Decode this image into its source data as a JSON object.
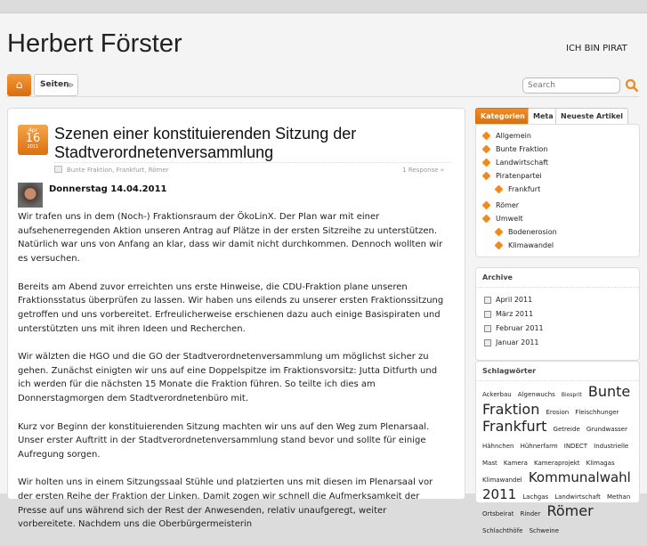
{
  "site": {
    "title": "Herbert Förster",
    "tagline": "ICH BIN PIRAT"
  },
  "nav": {
    "home_icon": "home-icon",
    "seiten_label": "Seiten",
    "search_placeholder": "Search"
  },
  "post": {
    "date": {
      "month": "Apr",
      "day": "16",
      "year": "2011"
    },
    "title": "Szenen einer konstituierenden Sitzung der Stadtverordnetenversammlung",
    "categories": "Bunte Fraktion, Frankfurt, Römer",
    "responses": "1 Response »",
    "subheading": "Donnerstag 14.04.2011",
    "paragraphs": [
      "Wir trafen uns in dem (Noch-) Fraktionsraum der ÖkoLinX. Der Plan war mit einer aufsehenerregenden Aktion unseren Antrag auf Plätze in der ersten Sitzreihe zu unterstützen. Natürlich war uns von Anfang an klar, dass wir damit nicht durchkommen. Dennoch wollten wir es versuchen.",
      "Bereits am Abend zuvor erreichten uns erste Hinweise, die CDU-Fraktion plane unseren Fraktionsstatus überprüfen zu lassen. Wir haben uns eilends zu unserer ersten Fraktionssitzung getroffen und uns vorbereitet. Erfreulicherweise erschienen dazu auch einige Basispiraten und unterstützten uns mit ihren Ideen und Recherchen.",
      "Wir wälzten die HGO und die GO der Stadtverordnetenversammlung um möglichst sicher zu gehen. Zunächst einigten wir uns auf eine Doppelspitze im Fraktionsvorsitz: Jutta Ditfurth und ich werden für die nächsten 15 Monate die Fraktion führen. So teilte ich dies am Donnerstagmorgen dem Stadtverordnetenbüro mit.",
      "Kurz vor Beginn der konstituierenden Sitzung machten wir uns auf den Weg zum Plenarsaal. Unser erster Auftritt in der Stadtverordnetenversammlung stand bevor und sollte für einige Aufregung sorgen.",
      "Wir holten uns in einem Sitzungssaal Stühle und platzierten uns mit diesen im Plenarsaal vor der ersten Reihe der Fraktion der Linken. Damit zogen wir schnell die Aufmerksamkeit der Presse auf uns während sich der Rest der Anwesenden, relativ unaufgeregt, weiter vorbereitete. Nachdem uns die Oberbürgermeisterin"
    ]
  },
  "sidebar": {
    "tabs": [
      "Kategorien",
      "Meta",
      "Neueste Artikel"
    ],
    "categories": [
      {
        "label": "Allgemein",
        "sub": false
      },
      {
        "label": "Bunte Fraktion",
        "sub": false
      },
      {
        "label": "Landwirtschaft",
        "sub": false
      },
      {
        "label": "Piratenpartei",
        "sub": false
      },
      {
        "label": "Frankfurt",
        "sub": true
      },
      {
        "label": "Römer",
        "sub": false
      },
      {
        "label": "Umwelt",
        "sub": false
      },
      {
        "label": "Bodenerosion",
        "sub": true
      },
      {
        "label": "Klimawandel",
        "sub": true
      }
    ],
    "archive_title": "Archive",
    "archive": [
      "April 2011",
      "März 2011",
      "Februar 2011",
      "Januar 2011"
    ],
    "tags_title": "Schlagwörter",
    "tags": [
      {
        "t": "Ackerbau",
        "s": 7
      },
      {
        "t": "Algenwuchs",
        "s": 7
      },
      {
        "t": "Biosprit",
        "s": 6
      },
      {
        "t": "Bunte Fraktion",
        "s": 16
      },
      {
        "t": "Erosion",
        "s": 7
      },
      {
        "t": "Fleischhunger",
        "s": 7
      },
      {
        "t": "Frankfurt",
        "s": 16
      },
      {
        "t": "Getreide",
        "s": 7
      },
      {
        "t": "Grundwasser",
        "s": 7
      },
      {
        "t": "Hähnchen",
        "s": 7
      },
      {
        "t": "Hühnerfarm",
        "s": 7
      },
      {
        "t": "INDECT",
        "s": 7
      },
      {
        "t": "Industrielle Mast",
        "s": 7
      },
      {
        "t": "Kamera",
        "s": 7
      },
      {
        "t": "Kameraprojekt",
        "s": 7
      },
      {
        "t": "Klimagas",
        "s": 7
      },
      {
        "t": "Klimawandel",
        "s": 7
      },
      {
        "t": "Kommunalwahl 2011",
        "s": 15
      },
      {
        "t": "Lachgas",
        "s": 7
      },
      {
        "t": "Landwirtschaft",
        "s": 7
      },
      {
        "t": "Methan",
        "s": 7
      },
      {
        "t": "Ortsbeirat",
        "s": 7
      },
      {
        "t": "Rinder",
        "s": 7
      },
      {
        "t": "Römer",
        "s": 16
      },
      {
        "t": "Schlachthöfe",
        "s": 7
      },
      {
        "t": "Schweine",
        "s": 7
      }
    ]
  }
}
